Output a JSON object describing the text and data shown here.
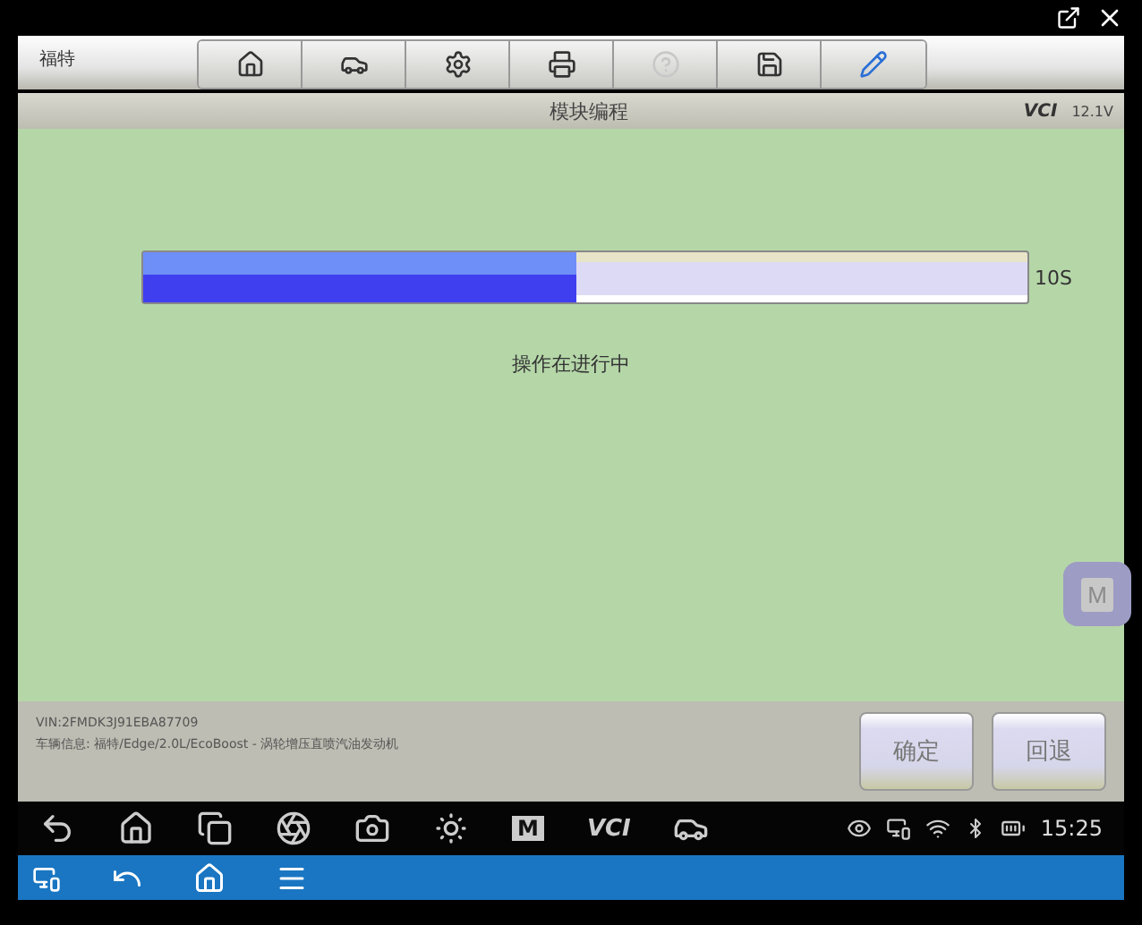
{
  "window": {
    "brand": "福特"
  },
  "toolbar": [
    {
      "kind": "home",
      "disabled": false
    },
    {
      "kind": "car-lift",
      "disabled": false
    },
    {
      "kind": "settings",
      "disabled": false
    },
    {
      "kind": "print",
      "disabled": false
    },
    {
      "kind": "help",
      "disabled": true
    },
    {
      "kind": "save",
      "disabled": false
    },
    {
      "kind": "pen",
      "disabled": false
    }
  ],
  "title_bar": {
    "title": "模块编程",
    "vci_label": "VCI",
    "battery_reading": "12.1V"
  },
  "progress": {
    "level": 0.49,
    "reading": "10S",
    "message": "操作在进行中"
  },
  "floating_button": {
    "label": "M"
  },
  "vehicle_info": {
    "vin": "VIN:2FMDK3J91EBA87709",
    "info": "车辆信息: 福特/Edge/2.0L/EcoBoost - 涡轮增压直喷汽油发动机"
  },
  "buttons": [
    {
      "label": "确定"
    },
    {
      "label": "回退"
    }
  ],
  "nav_bar": {
    "m_label": "M",
    "vci_label": "VCI",
    "time": "15:25"
  }
}
